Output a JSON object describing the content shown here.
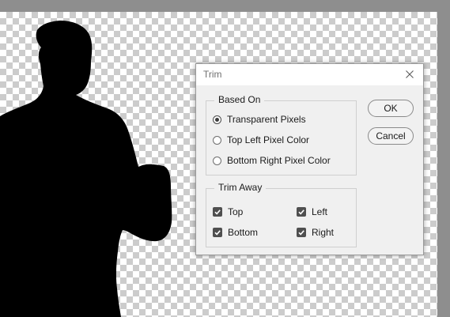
{
  "dialog": {
    "title": "Trim",
    "based_on": {
      "legend": "Based On",
      "options": [
        {
          "label": "Transparent Pixels",
          "selected": true
        },
        {
          "label": "Top Left Pixel Color",
          "selected": false
        },
        {
          "label": "Bottom Right Pixel Color",
          "selected": false
        }
      ]
    },
    "trim_away": {
      "legend": "Trim Away",
      "options": [
        {
          "label": "Top",
          "checked": true
        },
        {
          "label": "Left",
          "checked": true
        },
        {
          "label": "Bottom",
          "checked": true
        },
        {
          "label": "Right",
          "checked": true
        }
      ]
    },
    "buttons": {
      "ok": "OK",
      "cancel": "Cancel"
    }
  },
  "icons": {
    "close": "close-icon",
    "checkmark": "checkmark-icon"
  },
  "colors": {
    "workspace": "#8e8e8e",
    "checker_light": "#ffffff",
    "checker_dark": "#cccccc",
    "silhouette": "#000000",
    "dialog_bg": "#f0f0f0"
  }
}
